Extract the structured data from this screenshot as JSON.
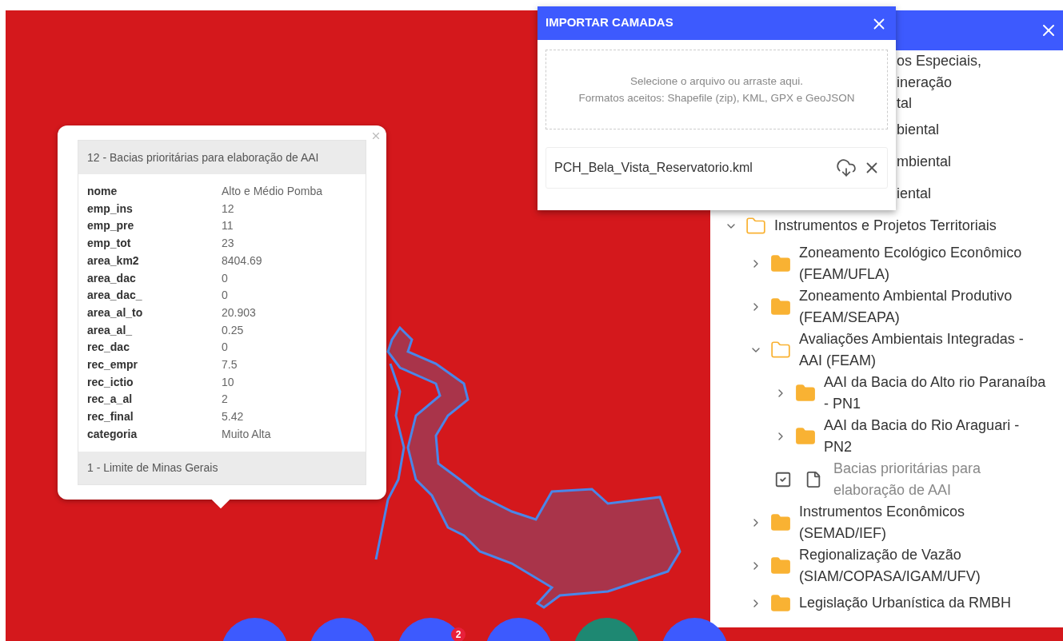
{
  "popup": {
    "title": "12 - Bacias prioritárias para elaboração de AAI",
    "rows": [
      {
        "key": "nome",
        "value": "Alto e Médio Pomba"
      },
      {
        "key": "emp_ins",
        "value": "12"
      },
      {
        "key": "emp_pre",
        "value": "11"
      },
      {
        "key": "emp_tot",
        "value": "23"
      },
      {
        "key": "area_km2",
        "value": "8404.69"
      },
      {
        "key": "area_dac",
        "value": "0"
      },
      {
        "key": "area_dac_",
        "value": "0"
      },
      {
        "key": "area_al_to",
        "value": "20.903"
      },
      {
        "key": "area_al_",
        "value": "0.25"
      },
      {
        "key": "rec_dac",
        "value": "0"
      },
      {
        "key": "rec_empr",
        "value": "7.5"
      },
      {
        "key": "rec_ictio",
        "value": "10"
      },
      {
        "key": "rec_a_al",
        "value": "2"
      },
      {
        "key": "rec_final",
        "value": "5.42"
      },
      {
        "key": "categoria",
        "value": "Muito Alta"
      }
    ],
    "footer": "1 - Limite de Minas Gerais"
  },
  "import_dialog": {
    "title": "IMPORTAR CAMADAS",
    "dropzone": [
      "Selecione o arquivo ou arraste aqui.",
      "Formatos aceitos: Shapefile (zip), KML, GPX e GeoJSON"
    ],
    "file": "PCH_Bela_Vista_Reservatorio.kml"
  },
  "layers_panel": {
    "covered_rows": [
      {
        "lines": [
          "os Especiais,",
          "ineração",
          "tal"
        ]
      },
      {
        "lines": [
          "biental"
        ]
      },
      {
        "lines": [
          "mbiental"
        ]
      },
      {
        "lines": [
          "iental"
        ]
      }
    ],
    "tree": [
      {
        "kind": "folder",
        "label": "Instrumentos e Projetos Territoriais",
        "expanded": true,
        "children": [
          {
            "kind": "folder",
            "label": "Zoneamento Ecológico Econômico (FEAM/UFLA)",
            "expanded": false
          },
          {
            "kind": "folder",
            "label": "Zoneamento Ambiental Produtivo (FEAM/SEAPA)",
            "expanded": false
          },
          {
            "kind": "folder",
            "label": "Avaliações Ambientais Integradas - AAI (FEAM)",
            "expanded": true,
            "children": [
              {
                "kind": "folder",
                "label": "AAI da Bacia do Alto rio Paranaíba - PN1",
                "expanded": false
              },
              {
                "kind": "folder",
                "label": "AAI da Bacia do Rio Araguari - PN2",
                "expanded": false
              },
              {
                "kind": "layer",
                "label": "Bacias prioritárias para elaboração de AAI",
                "checked": true
              }
            ]
          },
          {
            "kind": "folder",
            "label": "Instrumentos Econômicos (SEMAD/IEF)",
            "expanded": false
          },
          {
            "kind": "folder",
            "label": "Regionalização de Vazão (SIAM/COPASA/IGAM/UFV)",
            "expanded": false
          },
          {
            "kind": "folder",
            "label": "Legislação Urbanística da RMBH",
            "expanded": false
          }
        ]
      }
    ]
  },
  "fab_buttons": [
    {
      "color": "#3d5afe"
    },
    {
      "color": "#3d5afe"
    },
    {
      "color": "#3d5afe",
      "badge": "2"
    },
    {
      "color": "#3d5afe"
    },
    {
      "color": "#1e8872"
    },
    {
      "color": "#3d5afe"
    }
  ]
}
